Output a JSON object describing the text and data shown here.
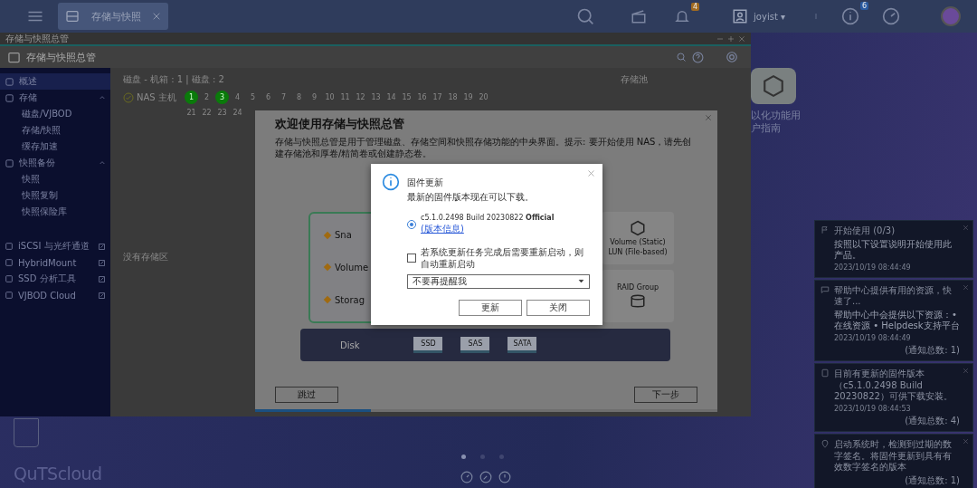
{
  "top_bar": {
    "app_tab": {
      "label": "存储与快照",
      "selected": true
    },
    "notifications_badge": "4",
    "user": "joyist ▾",
    "info_badge": "6"
  },
  "app_window": {
    "caption": "存储与快照总管",
    "title": "存储与快照总管",
    "sidebar": {
      "items": [
        {
          "label": "概述",
          "selected": true
        },
        {
          "label": "存储",
          "selected": false,
          "expanded": true,
          "children": [
            {
              "label": "磁盘/VJBOD",
              "selected": false
            },
            {
              "label": "存储/快照",
              "selected": false
            },
            {
              "label": "缓存加速",
              "selected": false
            }
          ]
        },
        {
          "label": "快照备份",
          "selected": false,
          "expanded": true,
          "children": [
            {
              "label": "快照",
              "selected": false
            },
            {
              "label": "快照复制",
              "selected": false
            },
            {
              "label": "快照保险库",
              "selected": false
            }
          ]
        }
      ],
      "links": [
        {
          "label": "iSCSI 与光纤通道"
        },
        {
          "label": "HybridMount"
        },
        {
          "label": "SSD 分析工具"
        },
        {
          "label": "VJBOD Cloud"
        }
      ]
    },
    "summary": "磁盘 - 机箱 : 1 | 磁盘 : 2",
    "pool_heading": "存储池",
    "host": "NAS 主机",
    "empty_note": "没有存储区",
    "slots_row_1": [
      {
        "label": "1",
        "used": true
      },
      {
        "label": "2",
        "used": false
      },
      {
        "label": "3",
        "used": true
      },
      {
        "label": "4",
        "used": false
      },
      {
        "label": "5",
        "used": false
      },
      {
        "label": "6",
        "used": false
      },
      {
        "label": "7",
        "used": false
      },
      {
        "label": "8",
        "used": false
      },
      {
        "label": "9",
        "used": false
      },
      {
        "label": "10",
        "used": false
      },
      {
        "label": "11",
        "used": false
      },
      {
        "label": "12",
        "used": false
      },
      {
        "label": "13",
        "used": false
      },
      {
        "label": "14",
        "used": false
      },
      {
        "label": "15",
        "used": false
      },
      {
        "label": "16",
        "used": false
      },
      {
        "label": "17",
        "used": false
      },
      {
        "label": "18",
        "used": false
      },
      {
        "label": "19",
        "used": false
      },
      {
        "label": "20",
        "used": false
      }
    ],
    "slots_row_2": [
      {
        "label": "21"
      },
      {
        "label": "22"
      },
      {
        "label": "23"
      },
      {
        "label": "24"
      }
    ]
  },
  "welcome": {
    "title": "欢迎使用存储与快照总管",
    "text": "存储与快照总管是用于管理磁盘、存储空间和快照存储功能的中央界面。提示: 要开始使用 NAS，请先创建存储池和厚卷/精简卷或创建静态卷。",
    "layers": [
      "Sna",
      "Volume",
      "Storag"
    ],
    "static_volume": "Volume (Static)",
    "lun": "LUN (File-based)",
    "raid": "RAID Group",
    "disk": "Disk",
    "disk_types": [
      "SSD",
      "SAS",
      "SATA"
    ],
    "back_button": "跳过",
    "next_button": "下一步",
    "progress": {
      "level": 0.25
    }
  },
  "firmware_dialog": {
    "title": "固件更新",
    "message": "最新的固件版本现在可以下载。",
    "option": {
      "text": "c5.1.0.2498 Build 20230822 **Official**",
      "link": "(版本信息)",
      "selected": true
    },
    "auto_restart": {
      "label": "若系统更新任务完成后需要重新启动，则自动重新启动",
      "checked": false
    },
    "reminder": {
      "value": "不要再提醒我"
    },
    "buttons": [
      "更新",
      "关闭"
    ]
  },
  "desktop": {
    "shortcut": "以化功能用户指南",
    "logo": "QuTScloud",
    "pages": [
      {
        "selected": true
      },
      {
        "selected": false
      },
      {
        "selected": false
      }
    ]
  },
  "notifications": [
    {
      "kind": "flag",
      "title": "开始使用 (0/3)",
      "body": "按照以下设置说明开始使用此产品。",
      "time": "2023/10/19 08:44:49"
    },
    {
      "kind": "chat",
      "title": "帮助中心提供有用的资源，快速了...",
      "body": "帮助中心中会提供以下资源：• 在线资源 • Helpdesk支持平台",
      "time": "2023/10/19 08:44:49",
      "count": "(通知总数: 1)"
    },
    {
      "kind": "chip",
      "title": "目前有更新的固件版本（c5.1.0.2498 Build 20230822）可供下载安装。",
      "time": "2023/10/19 08:44:53",
      "count": "(通知总数: 4)"
    },
    {
      "kind": "pin",
      "title": "启动系统时，检测到过期的数字签名。将固件更新到具有有效数字签名的版本",
      "count": "(通知总数: 1)"
    }
  ]
}
